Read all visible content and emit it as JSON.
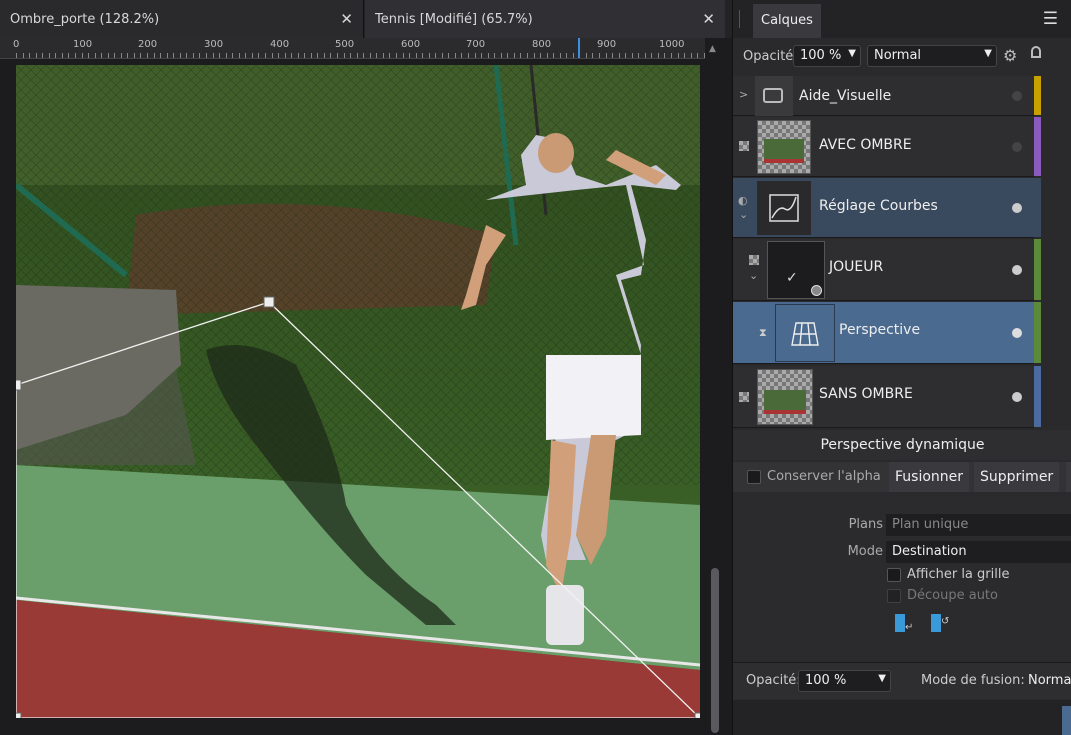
{
  "tabs": [
    {
      "label": "Ombre_porte (128.2%)"
    },
    {
      "label": "Tennis [Modifié] (65.7%)"
    }
  ],
  "ruler": {
    "labels": [
      "0",
      "100",
      "200",
      "300",
      "400",
      "500",
      "600",
      "700",
      "800",
      "900",
      "1000"
    ]
  },
  "layers_panel": {
    "tab_label": "Calques",
    "opacity_label": "Opacité:",
    "opacity_value": "100 %",
    "blend_mode": "Normal",
    "layers": [
      {
        "name": "Aide_Visuelle",
        "color": "#c8a000"
      },
      {
        "name": "AVEC OMBRE",
        "color": "#8a5abf"
      },
      {
        "name": "Réglage Courbes",
        "color": "#3a4a5e"
      },
      {
        "name": "JOUEUR",
        "color": "#5a8a3a"
      },
      {
        "name": "Perspective",
        "color": "#5a8a3a"
      },
      {
        "name": "SANS OMBRE",
        "color": "#4a6aa0"
      }
    ]
  },
  "perspective_panel": {
    "title": "Perspective dynamique",
    "preserve_alpha": "Conserver l'alpha",
    "merge": "Fusionner",
    "delete": "Supprimer",
    "planes_label": "Plans",
    "planes_value": "Plan unique",
    "mode_label": "Mode",
    "mode_value": "Destination",
    "show_grid": "Afficher la grille",
    "auto_crop": "Découpe auto",
    "opacity_label": "Opacité:",
    "opacity_value": "100 %",
    "blend_label": "Mode de fusion:",
    "blend_value": "Normal"
  },
  "icons": [
    "close-icon",
    "menu-icon",
    "gear-icon",
    "lock-icon",
    "chevron-down-icon",
    "curves-icon",
    "perspective-grid-icon",
    "checker-icon"
  ]
}
